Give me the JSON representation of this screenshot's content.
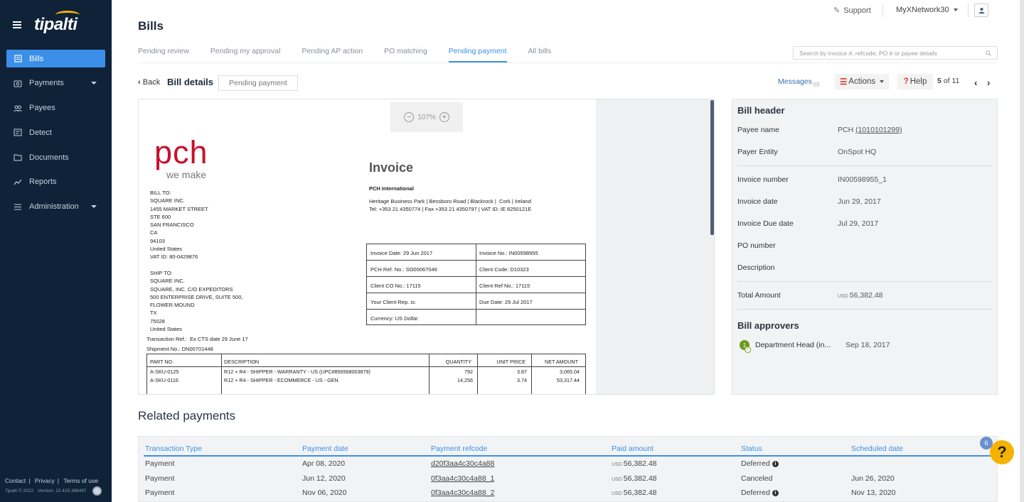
{
  "brand": {
    "name": "tipalti"
  },
  "sidebar": {
    "items": [
      {
        "label": "Bills",
        "icon": "bills-icon",
        "active": true
      },
      {
        "label": "Payments",
        "icon": "payments-icon",
        "has_caret": true
      },
      {
        "label": "Payees",
        "icon": "payees-icon"
      },
      {
        "label": "Detect",
        "icon": "detect-icon"
      },
      {
        "label": "Documents",
        "icon": "documents-icon"
      },
      {
        "label": "Reports",
        "icon": "reports-icon"
      },
      {
        "label": "Administration",
        "icon": "administration-icon",
        "has_caret": true
      }
    ],
    "footer": {
      "contact": "Contact",
      "privacy": "Privacy",
      "terms": "Terms of use",
      "copyright": "Tipalti © 2022",
      "version": "Version: 22.425.368497"
    }
  },
  "topbar": {
    "support": "Support",
    "network": "MyXNetwork30"
  },
  "page": {
    "title": "Bills",
    "tabs": [
      {
        "label": "Pending review"
      },
      {
        "label": "Pending my approval"
      },
      {
        "label": "Pending AP action"
      },
      {
        "label": "PO matching"
      },
      {
        "label": "Pending payment",
        "active": true
      },
      {
        "label": "All bills"
      }
    ],
    "search_placeholder": "Search by invoice #, refcode, PO # or payee details"
  },
  "subbar": {
    "back": "Back",
    "title": "Bill details",
    "status": "Pending payment",
    "messages": "Messages",
    "messages_count": "(0)",
    "actions": "Actions",
    "help": "Help",
    "pager_current": "5",
    "pager_of": "of 11"
  },
  "viewer": {
    "zoom": "107%",
    "logo_text": "pch",
    "logo_tagline": "we make",
    "bill_to": "BILL TO:\nSQUARE INC.\n1455 MARKET STREET\nSTE 600\nSAN FRANCISCO\nCA\n94103\nUnited States\nVAT ID: 80-0429876",
    "ship_to": "SHIP TO:\nSQUARE INC.\nSQUARE, INC. C/O EXPEDITORS\n500 ENTERPRISE DRIVE, SUITE 500,\nFLOWER MOUND\nTX\n75028\nUnited States",
    "transaction_ref": "Transaction Ref.:  Ex CTS date 29 June 17",
    "shipment_no": "Shipment No.: DN00701448",
    "invoice_title": "Invoice",
    "company": "PCH International",
    "company_address": "Heritage Business Park | Bessboro Road | Blackrock |  Cork | Ireland",
    "company_contact": "Tel: +353 21 4350774 | Fax +353 21 4350797 | VAT ID: IE 8250121E",
    "box": {
      "invoice_date": "Invoice Date:  29 Jun 2017",
      "invoice_no": "Invoice No.:  IN00598955",
      "pch_ref": "PCH Ref. No.:  SO00067046",
      "client_code": "Client Code:  D10323",
      "client_co_no": "Client CO No.:  17115",
      "client_ref_no": "Client Ref No.:  17115",
      "client_rep": "Your Client Rep. is:",
      "due_date": "Due Date:  29 Jul 2017",
      "currency": "Currency:  US Dollar"
    },
    "line_table": {
      "headers": [
        "PART NO.",
        "DESCRIPTION",
        "QUANTITY",
        "UNIT PRICE",
        "NET AMOUNT"
      ],
      "rows": [
        [
          "A-SKU-0125",
          "R12 + R4 - SHIPPER - WARRANTY - US (UPC#856568003879)",
          "792",
          "3.87",
          "3,065.04"
        ],
        [
          "A-SKU-0116",
          "R12 + R4 - SHIPPER - ECOMMERCE - US - GEN",
          "14,256",
          "3.74",
          "53,317.44"
        ]
      ]
    }
  },
  "bill_header": {
    "title": "Bill header",
    "payee_name_label": "Payee name",
    "payee_name": "PCH",
    "payee_id": "(1010101299)",
    "payer_entity_label": "Payer Entity",
    "payer_entity": "OnSpot HQ",
    "invoice_number_label": "Invoice number",
    "invoice_number": "IN00598955_1",
    "invoice_date_label": "Invoice date",
    "invoice_date": "Jun 29, 2017",
    "invoice_due_label": "Invoice Due date",
    "invoice_due": "Jul 29, 2017",
    "po_number_label": "PO number",
    "description_label": "Description",
    "total_label": "Total Amount",
    "total_currency": "USD",
    "total_amount": "56,382.48",
    "approvers_title": "Bill approvers",
    "approver_step": "1",
    "approver_name": "Department Head (in...",
    "approver_date": "Sep 18, 2017"
  },
  "related_payments": {
    "title": "Related payments",
    "headers": [
      "Transaction Type",
      "Payment date",
      "Payment refcode",
      "Paid amount",
      "Status",
      "Scheduled date"
    ],
    "currency": "USD",
    "rows": [
      {
        "type": "Payment",
        "date": "Apr 08, 2020",
        "refcode": "d20f3aa4c30c4a88",
        "amount": "56,382.48",
        "status": "Deferred",
        "status_info": true,
        "scheduled": ""
      },
      {
        "type": "Payment",
        "date": "Jun 12, 2020",
        "refcode": "0f3aa4c30c4a88_1",
        "amount": "56,382.48",
        "status": "Canceled",
        "status_info": false,
        "scheduled": "Jun 26, 2020"
      },
      {
        "type": "Payment",
        "date": "Nov 06, 2020",
        "refcode": "0f3aa4c30c4a88_2",
        "amount": "56,382.48",
        "status": "Deferred",
        "status_info": true,
        "scheduled": "Nov 13, 2020"
      }
    ]
  },
  "help_fab": {
    "label": "?",
    "badge": "6"
  },
  "colors": {
    "sidebar": "#0f2237",
    "accent": "#3c8fe8",
    "brand_yellow": "#f5b301",
    "danger": "#d8362f"
  }
}
